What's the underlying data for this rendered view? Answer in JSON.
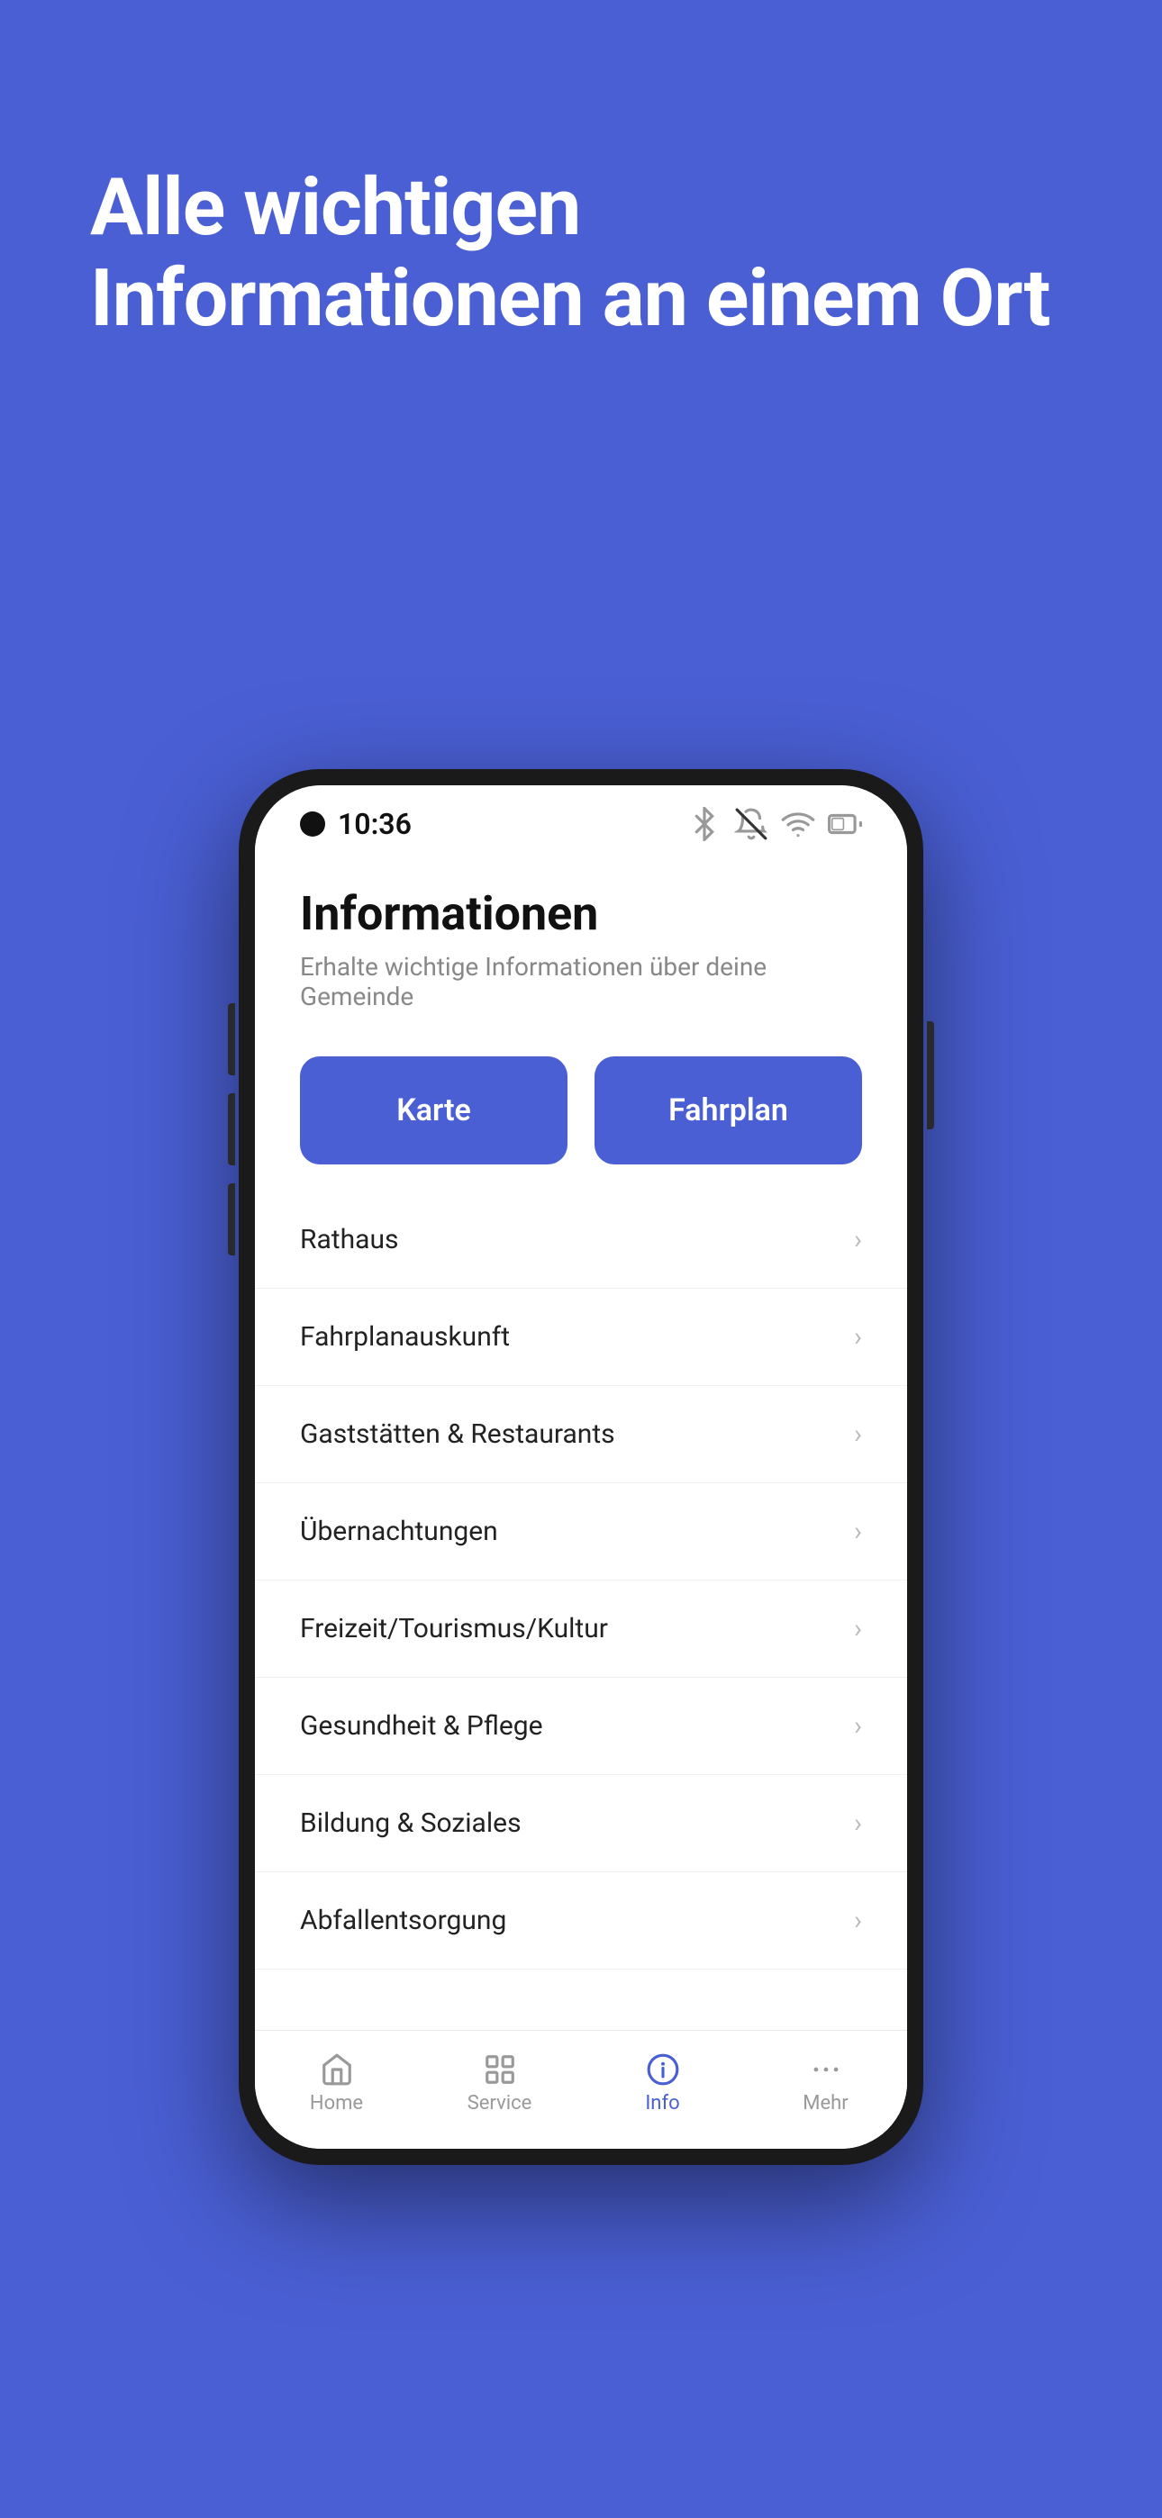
{
  "background_color": "#4a5fd4",
  "hero": {
    "title": "Alle wichtigen Informationen an einem Ort"
  },
  "phone": {
    "status_bar": {
      "time": "10:36",
      "icons": [
        "bluetooth",
        "bell-off",
        "wifi",
        "battery"
      ]
    },
    "app": {
      "title": "Informationen",
      "subtitle": "Erhalte wichtige Informationen über deine Gemeinde",
      "quick_buttons": [
        {
          "label": "Karte"
        },
        {
          "label": "Fahrplan"
        }
      ],
      "menu_items": [
        {
          "label": "Rathaus"
        },
        {
          "label": "Fahrplanauskunft"
        },
        {
          "label": "Gaststätten & Restaurants"
        },
        {
          "label": "Übernachtungen"
        },
        {
          "label": "Freizeit/Tourismus/Kultur"
        },
        {
          "label": "Gesundheit & Pflege"
        },
        {
          "label": "Bildung & Soziales"
        },
        {
          "label": "Abfallentsorgung"
        }
      ],
      "nav": {
        "items": [
          {
            "label": "Home",
            "icon": "home",
            "active": false
          },
          {
            "label": "Service",
            "icon": "grid",
            "active": false
          },
          {
            "label": "Info",
            "icon": "info-circle",
            "active": true
          },
          {
            "label": "Mehr",
            "icon": "more",
            "active": false
          }
        ]
      }
    }
  }
}
